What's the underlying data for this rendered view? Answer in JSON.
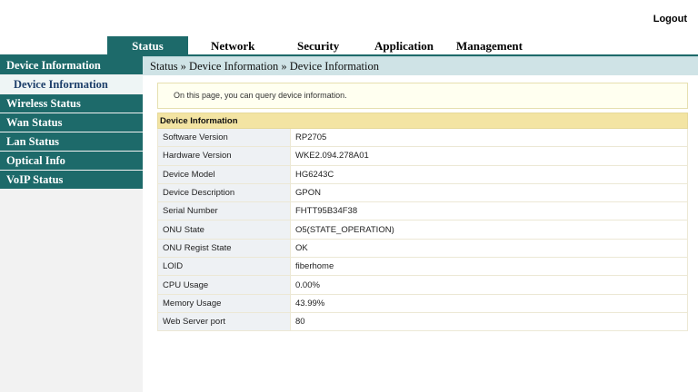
{
  "header": {
    "logout_label": "Logout"
  },
  "nav": {
    "tabs": [
      {
        "label": "Status",
        "active": true
      },
      {
        "label": "Network",
        "active": false
      },
      {
        "label": "Security",
        "active": false
      },
      {
        "label": "Application",
        "active": false
      },
      {
        "label": "Management",
        "active": false
      }
    ]
  },
  "sidebar": {
    "items": [
      {
        "label": "Device Information"
      },
      {
        "label": "Device Information"
      },
      {
        "label": "Wireless Status"
      },
      {
        "label": "Wan Status"
      },
      {
        "label": "Lan Status"
      },
      {
        "label": "Optical Info"
      },
      {
        "label": "VoIP Status"
      }
    ]
  },
  "breadcrumb": "Status » Device Information » Device Information",
  "notice": "On this page, you can query device information.",
  "table": {
    "title": "Device Information",
    "rows": [
      {
        "label": "Software Version",
        "value": "RP2705"
      },
      {
        "label": "Hardware Version",
        "value": "WKE2.094.278A01"
      },
      {
        "label": "Device Model",
        "value": "HG6243C"
      },
      {
        "label": "Device Description",
        "value": "GPON"
      },
      {
        "label": "Serial Number",
        "value": "FHTT95B34F38"
      },
      {
        "label": "ONU State",
        "value": "O5(STATE_OPERATION)"
      },
      {
        "label": "ONU Regist State",
        "value": "OK"
      },
      {
        "label": "LOID",
        "value": "fiberhome"
      },
      {
        "label": "CPU Usage",
        "value": "0.00%"
      },
      {
        "label": "Memory Usage",
        "value": "43.99%"
      },
      {
        "label": "Web Server port",
        "value": "80"
      }
    ]
  },
  "colors": {
    "teal": "#1d6a6a",
    "breadcrumb_bg": "#cfe3e6",
    "table_header_bg": "#f3e4a3",
    "notice_bg": "#fffff0"
  }
}
